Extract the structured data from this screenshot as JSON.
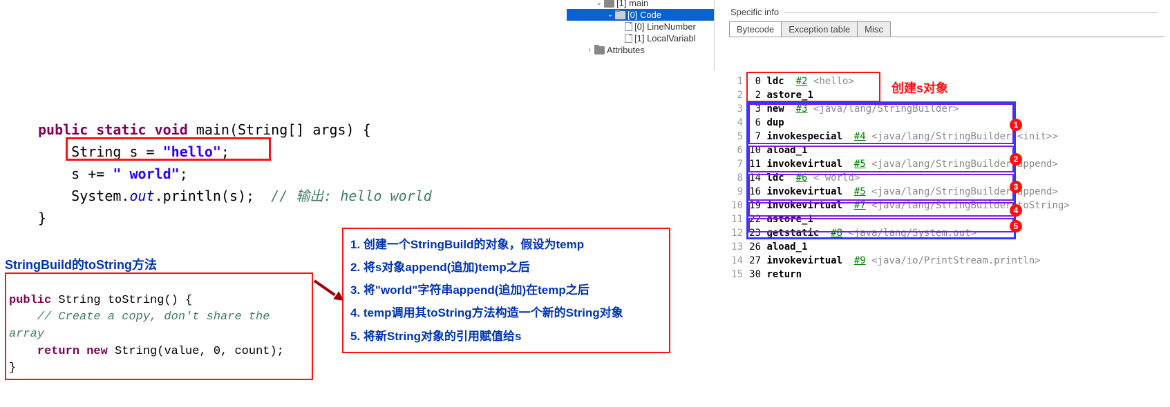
{
  "java_src": {
    "sig_kw": "public static void",
    "sig_rest": " main(String[] args) {",
    "l1_a": "    String s = ",
    "l1_str": "\"hello\"",
    "l1_b": ";",
    "l2_a": "    s += ",
    "l2_str": "\" world\"",
    "l2_b": ";",
    "l3_a": "    System.",
    "l3_out": "out",
    "l3_b": ".println(s);  ",
    "l3_cmt": "// 输出: hello world",
    "close": "}"
  },
  "ts_title": "StringBuild的toString方法",
  "ts_code": {
    "sig_kw": "public",
    "sig_rest": " String toString() {",
    "cmt": "    // Create a copy, don't share the\narray",
    "ret_kw": "    return new",
    "ret_rest": " String(value, 0, count);",
    "close": "}"
  },
  "steps": [
    "1. 创建一个StringBuild的对象，假设为temp",
    "2. 将s对象append(追加)temp之后",
    "3. 将\"world\"字符串append(追加)在temp之后",
    "4. temp调用其toString方法构造一个新的String对象",
    "5. 将新String对象的引用赋值给s"
  ],
  "tree": {
    "n0": "[1] main",
    "n1": "[0] Code",
    "n2": "[0] LineNumber",
    "n3": "[1] LocalVariabl",
    "n4": "Attributes"
  },
  "spec_title": "Specific info",
  "tabs": {
    "t0": "Bytecode",
    "t1": "Exception table",
    "t2": "Misc"
  },
  "bytecode": [
    {
      "ln": "1",
      "off": "0",
      "op": "ldc",
      "ref": "#2",
      "arg": "<hello>"
    },
    {
      "ln": "2",
      "off": "2",
      "op": "astore_1",
      "ref": "",
      "arg": ""
    },
    {
      "ln": "3",
      "off": "3",
      "op": "new",
      "ref": "#3",
      "arg": "<java/lang/StringBuilder>"
    },
    {
      "ln": "4",
      "off": "6",
      "op": "dup",
      "ref": "",
      "arg": ""
    },
    {
      "ln": "5",
      "off": "7",
      "op": "invokespecial",
      "ref": "#4",
      "arg": "<java/lang/StringBuilder.<init>>"
    },
    {
      "ln": "6",
      "off": "10",
      "op": "aload_1",
      "ref": "",
      "arg": ""
    },
    {
      "ln": "7",
      "off": "11",
      "op": "invokevirtual",
      "ref": "#5",
      "arg": "<java/lang/StringBuilder.append>"
    },
    {
      "ln": "8",
      "off": "14",
      "op": "ldc",
      "ref": "#6",
      "arg": "< world>"
    },
    {
      "ln": "9",
      "off": "16",
      "op": "invokevirtual",
      "ref": "#5",
      "arg": "<java/lang/StringBuilder.append>"
    },
    {
      "ln": "10",
      "off": "19",
      "op": "invokevirtual",
      "ref": "#7",
      "arg": "<java/lang/StringBuilder.toString>"
    },
    {
      "ln": "11",
      "off": "22",
      "op": "astore_1",
      "ref": "",
      "arg": ""
    },
    {
      "ln": "12",
      "off": "23",
      "op": "getstatic",
      "ref": "#8",
      "arg": "<java/lang/System.out>"
    },
    {
      "ln": "13",
      "off": "26",
      "op": "aload_1",
      "ref": "",
      "arg": ""
    },
    {
      "ln": "14",
      "off": "27",
      "op": "invokevirtual",
      "ref": "#9",
      "arg": "<java/io/PrintStream.println>"
    },
    {
      "ln": "15",
      "off": "30",
      "op": "return",
      "ref": "",
      "arg": ""
    }
  ],
  "red_label": "创建s对象",
  "dots": [
    "1",
    "2",
    "3",
    "4",
    "5"
  ]
}
